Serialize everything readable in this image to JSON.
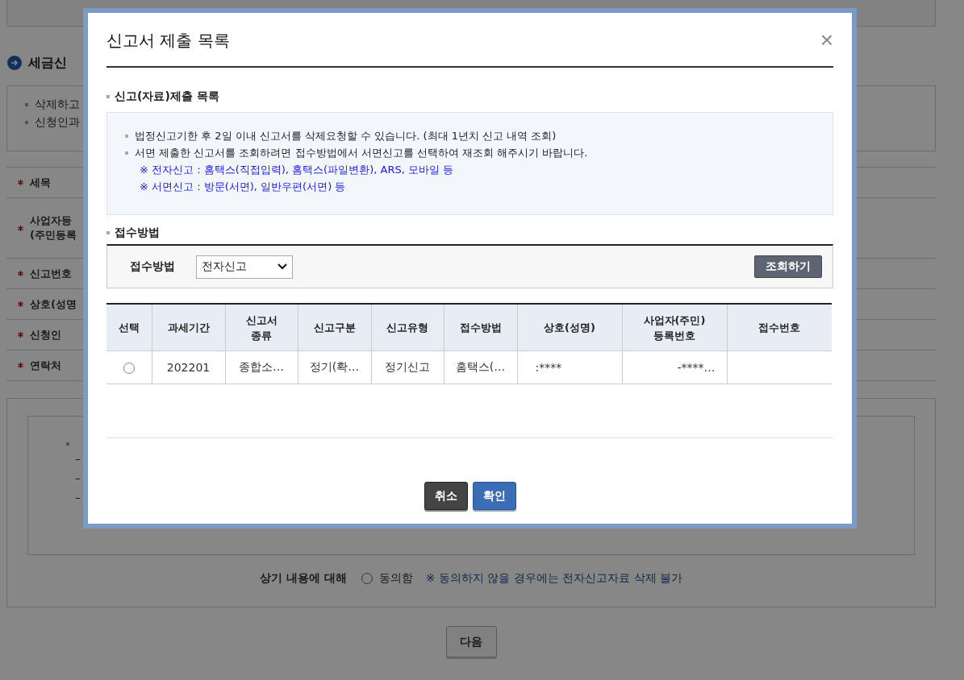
{
  "background": {
    "section_title": "세금신",
    "notes": [
      "삭제하고",
      "신청인과"
    ],
    "fields": [
      {
        "lines": [
          "세목"
        ]
      },
      {
        "lines": [
          "사업자등",
          "(주민등록"
        ]
      },
      {
        "lines": [
          "신고번호"
        ]
      },
      {
        "lines": [
          "상호(성명"
        ]
      },
      {
        "lines": [
          "신청인"
        ]
      },
      {
        "lines": [
          "연락처"
        ]
      }
    ],
    "guide": {
      "dashes": [
        "–",
        "–",
        "–"
      ]
    },
    "agreement": {
      "label": "상기 내용에 대해",
      "option": "동의함",
      "selected": false,
      "note": "※ 동의하지 않을 경우에는 전자신고자료 삭제 불가"
    },
    "next_button": "다음"
  },
  "dialog": {
    "title": "신고서 제출 목록",
    "close": "×",
    "list_heading": "신고(자료)제출 목록",
    "info": [
      {
        "kind": "bullet",
        "text": "법정신고기한 후 2일 이내 신고서를 삭제요청할 수 있습니다. (최대 1년치 신고 내역 조회)"
      },
      {
        "kind": "bullet",
        "text": "서면 제출한 신고서를 조회하려면 접수방법에서 서면신고를 선택하여 재조회 해주시기 바랍니다."
      },
      {
        "kind": "note",
        "text": "※ 전자신고 : 홈택스(직접입력), 홈택스(파일변환), ARS, 모바일 등"
      },
      {
        "kind": "note",
        "text": "※ 서면신고 : 방문(서면), 일반우편(서면) 등"
      }
    ],
    "method_heading": "접수방법",
    "filter": {
      "label": "접수방법",
      "value": "전자신고",
      "button": "조회하기"
    },
    "table": {
      "columns": [
        "선택",
        "과세기간",
        "신고서 종류",
        "신고구분",
        "신고유형",
        "접수방법",
        "상호(성명)",
        "사업자(주민) 등록번호",
        "접수번호"
      ],
      "rows": [
        {
          "selected": false,
          "cells": [
            "",
            "202201",
            "종합소…",
            "정기(확…",
            "정기신고",
            "홈택스(…",
            ":****",
            "-****…",
            ""
          ]
        }
      ]
    },
    "buttons": [
      {
        "kind": "cancel",
        "label": "취소"
      },
      {
        "kind": "confirm",
        "label": "확인"
      }
    ]
  }
}
